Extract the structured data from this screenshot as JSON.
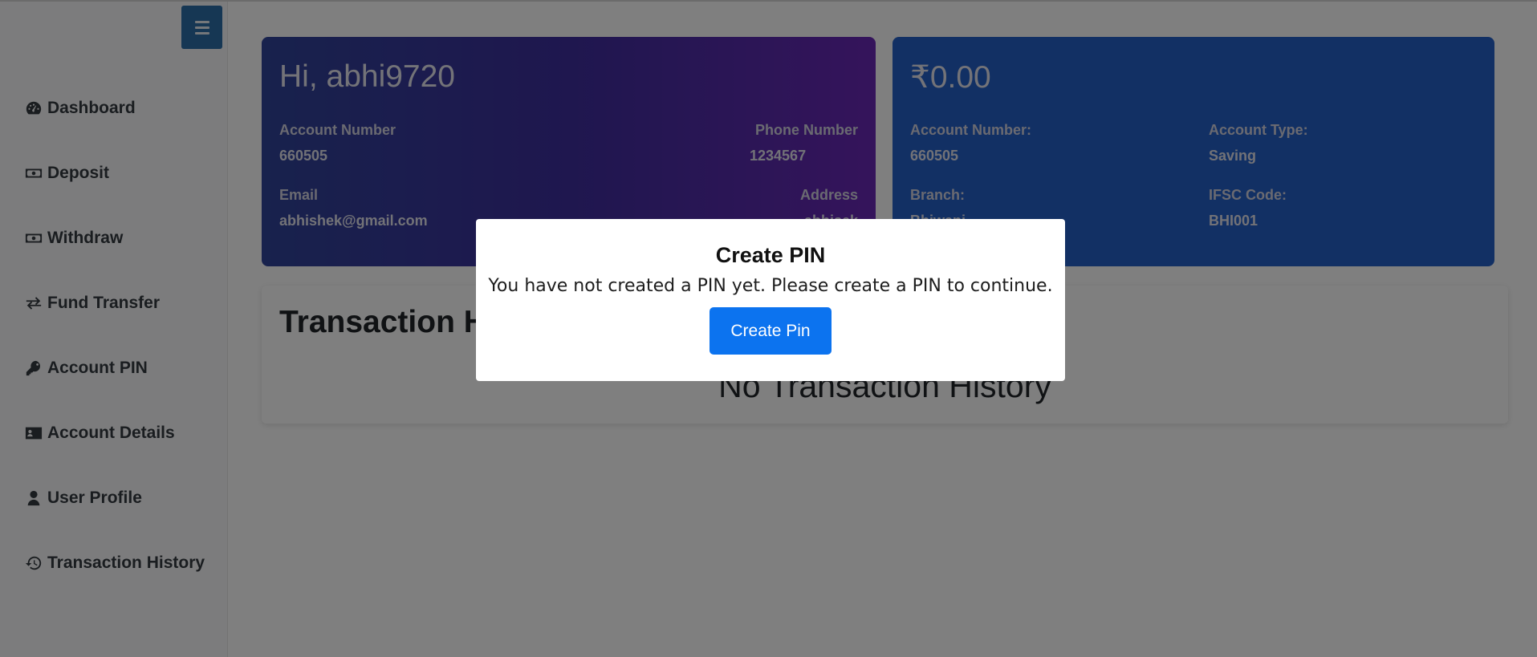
{
  "sidebar": {
    "items": [
      {
        "label": "Dashboard",
        "icon": "gauge-icon"
      },
      {
        "label": "Deposit",
        "icon": "money-bill-icon"
      },
      {
        "label": "Withdraw",
        "icon": "money-bill-icon"
      },
      {
        "label": "Fund Transfer",
        "icon": "exchange-icon"
      },
      {
        "label": "Account PIN",
        "icon": "key-icon"
      },
      {
        "label": "Account Details",
        "icon": "id-card-icon"
      },
      {
        "label": "User Profile",
        "icon": "user-icon"
      },
      {
        "label": "Transaction History",
        "icon": "history-icon"
      }
    ]
  },
  "user_card": {
    "greeting": "Hi, abhi9720",
    "account_number_label": "Account Number",
    "account_number": "660505",
    "phone_label": "Phone Number",
    "phone": "1234567",
    "email_label": "Email",
    "email": "abhishek@gmail.com",
    "address_label": "Address",
    "address": "abhisek"
  },
  "account_card": {
    "balance": "₹0.00",
    "account_number_label": "Account Number:",
    "account_number": "660505",
    "account_type_label": "Account Type:",
    "account_type": "Saving",
    "branch_label": "Branch:",
    "branch": "Bhiwani",
    "ifsc_label": "IFSC Code:",
    "ifsc": "BHI001"
  },
  "history": {
    "title": "Transaction History",
    "empty_message": "No Transaction History"
  },
  "modal": {
    "title": "Create PIN",
    "message": "You have not created a PIN yet. Please create a PIN to continue.",
    "button_label": "Create Pin"
  },
  "colors": {
    "sidebar_toggle": "#2d6fa9",
    "user_card_start": "#30449a",
    "user_card_end": "#6a28b7",
    "account_card": "#2460c8",
    "modal_button": "#0c73ef"
  }
}
